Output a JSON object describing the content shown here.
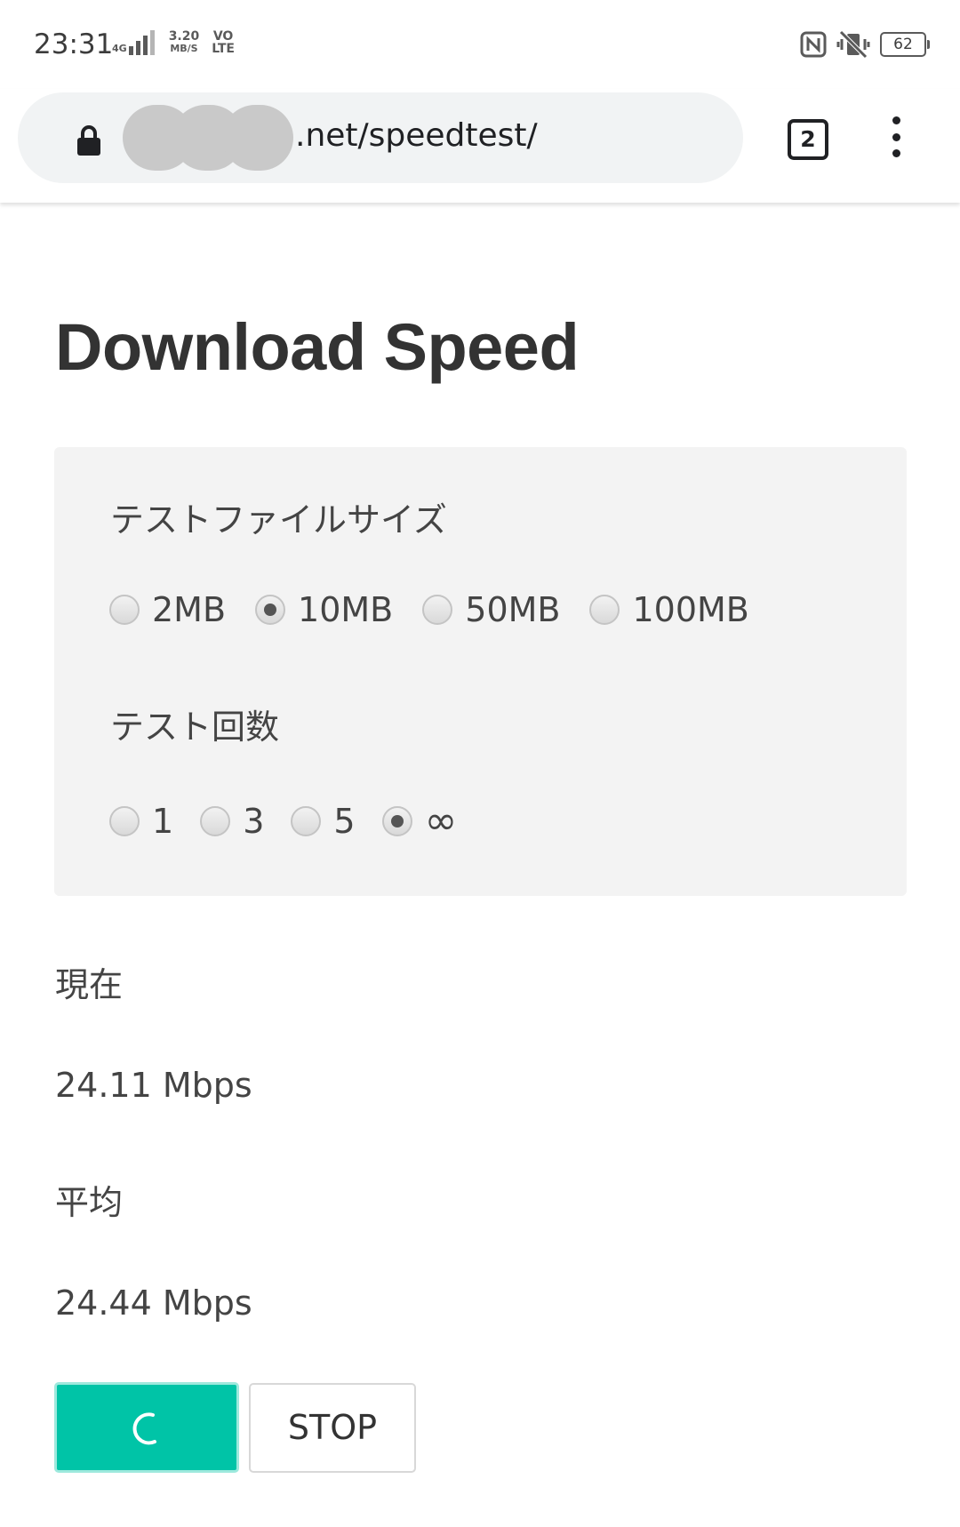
{
  "status_bar": {
    "time": "23:31",
    "network_type": "4G",
    "data_speed": "3.20",
    "data_speed_unit": "MB/S",
    "volte_top": "VO",
    "volte_bottom": "LTE",
    "battery_level": "62",
    "icons": [
      "signal-icon",
      "nfc-icon",
      "vibrate-icon",
      "battery-icon"
    ]
  },
  "browser": {
    "url_visible_suffix": ".net/speedtest/",
    "tab_count": "2",
    "icons": [
      "lock-icon",
      "more-menu-icon"
    ]
  },
  "page": {
    "title": "Download Speed",
    "settings": {
      "file_size_label": "テストファイルサイズ",
      "file_size_options": [
        "2MB",
        "10MB",
        "50MB",
        "100MB"
      ],
      "file_size_selected": "10MB",
      "test_count_label": "テスト回数",
      "test_count_options": [
        "1",
        "3",
        "5",
        "∞"
      ],
      "test_count_selected": "∞"
    },
    "results": {
      "current_label": "現在",
      "current_value": "24.11 Mbps",
      "average_label": "平均",
      "average_value": "24.44 Mbps"
    },
    "buttons": {
      "start_state": "loading",
      "stop_label": "STOP"
    }
  },
  "colors": {
    "accent": "#00c4a7",
    "panel_background": "#f3f3f3",
    "text": "#333333"
  }
}
